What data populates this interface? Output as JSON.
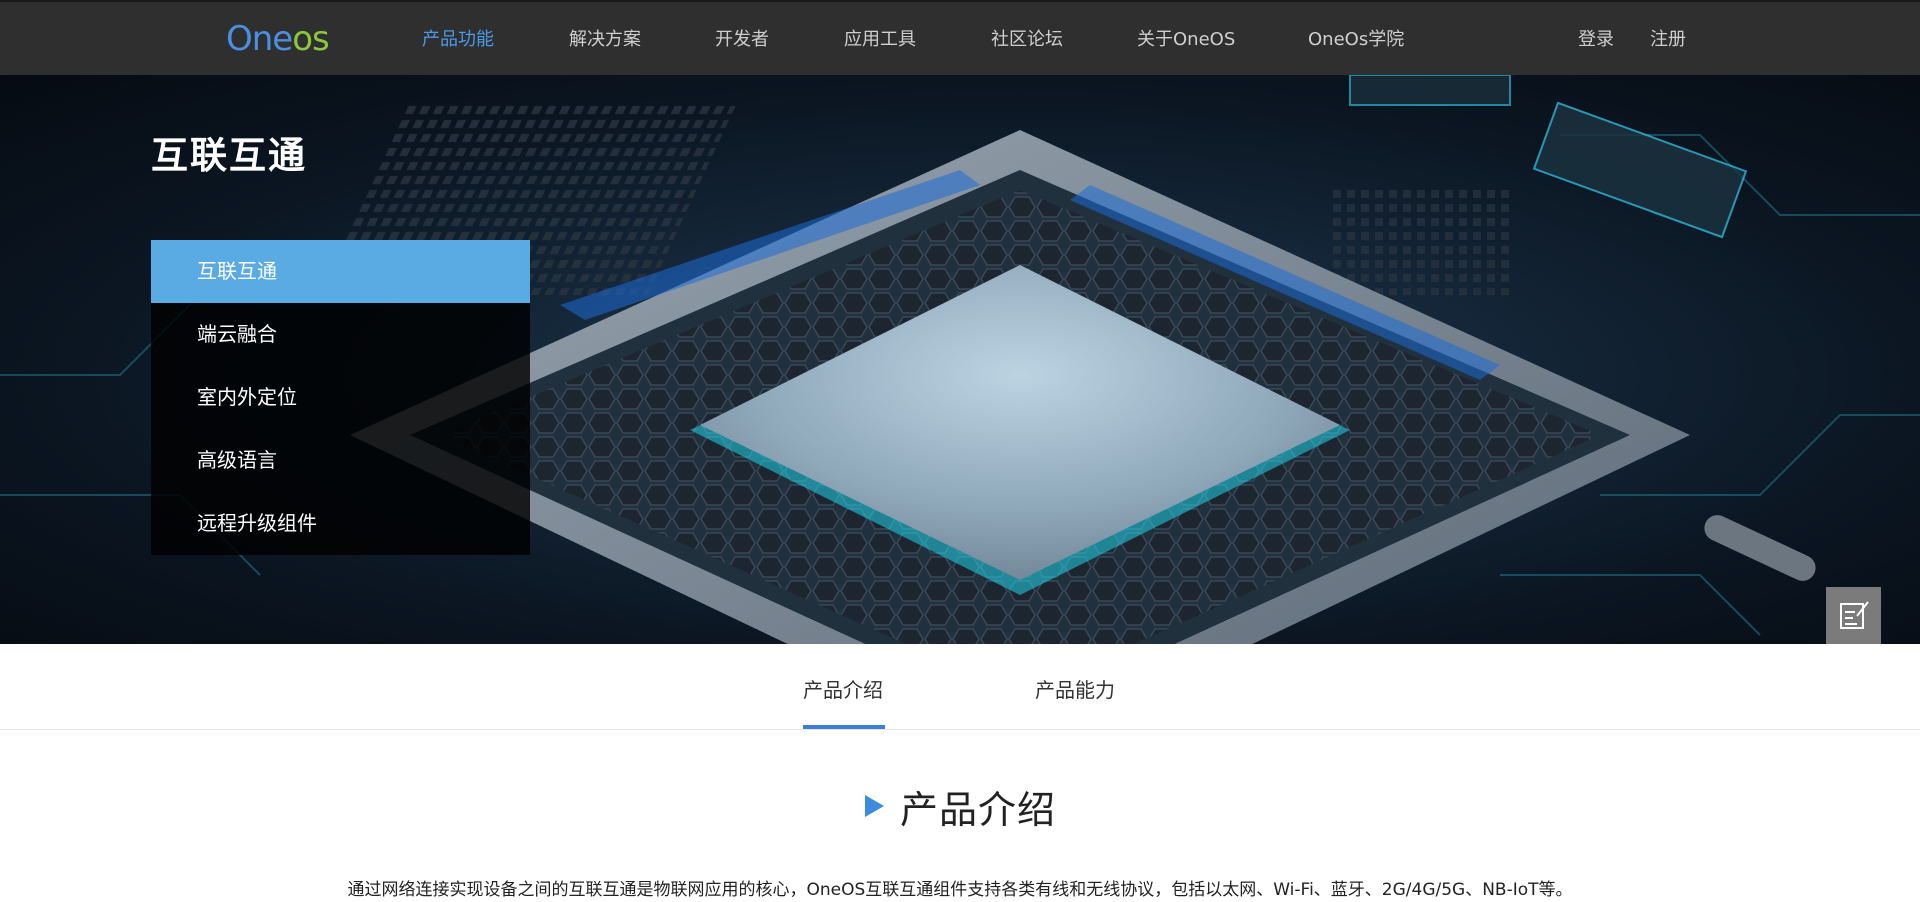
{
  "nav": {
    "logo_part1": "One",
    "logo_part2": "os",
    "items": [
      {
        "label": "产品功能",
        "active": true
      },
      {
        "label": "解决方案"
      },
      {
        "label": "开发者"
      },
      {
        "label": "应用工具"
      },
      {
        "label": "社区论坛"
      },
      {
        "label": "关于OneOS"
      },
      {
        "label": "OneOs学院"
      }
    ],
    "login": "登录",
    "register": "注册"
  },
  "hero": {
    "title": "互联互通",
    "menu": [
      {
        "label": "互联互通",
        "active": true
      },
      {
        "label": "端云融合"
      },
      {
        "label": "室内外定位"
      },
      {
        "label": "高级语言"
      },
      {
        "label": "远程升级组件"
      }
    ]
  },
  "float_tools": {
    "icons": [
      "edit-note-icon",
      "add-user-icon"
    ]
  },
  "tabs": [
    {
      "label": "产品介绍",
      "active": true
    },
    {
      "label": "产品能力"
    }
  ],
  "intro": {
    "title": "产品介绍",
    "text": "通过网络连接实现设备之间的互联互通是物联网应用的核心，OneOS互联互通组件支持各类有线和无线协议，包括以太网、Wi-Fi、蓝牙、2G/4G/5G、NB-IoT等。"
  },
  "colors": {
    "nav_bg": "#2f2f2f",
    "accent_blue": "#4a9be9",
    "menu_active": "#5aabe3",
    "tab_underline": "#3a7ed8",
    "logo_green": "#8cc63f"
  }
}
